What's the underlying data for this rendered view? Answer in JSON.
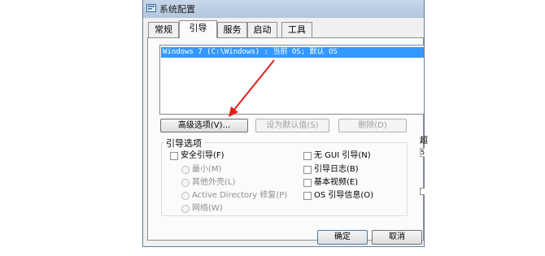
{
  "window": {
    "title": "系统配置"
  },
  "tabs": [
    {
      "label": "常规",
      "active": false
    },
    {
      "label": "引导",
      "active": true
    },
    {
      "label": "服务",
      "active": false
    },
    {
      "label": "启动",
      "active": false
    },
    {
      "label": "工具",
      "active": false
    }
  ],
  "boot_list": {
    "items": [
      "Windows 7 (C:\\Windows) : 当前 OS; 默认 OS"
    ],
    "selected_index": 0
  },
  "buttons": {
    "advanced": "高级选项(V)...",
    "set_default": "设为默认值(S)",
    "delete": "删除(D)",
    "ok": "确定",
    "cancel": "取消"
  },
  "boot_options": {
    "group_label": "引导选项",
    "safe_boot": "安全引导(F)",
    "minimal": "最小(M)",
    "alternate_shell": "其他外壳(L)",
    "active_directory_repair": "Active Directory 修复(P)",
    "network": "网络(W)",
    "no_gui_boot": "无 GUI 引导(N)",
    "boot_log": "引导日志(B)",
    "base_video": "基本视频(E)",
    "os_boot_info": "OS 引导信息(O)"
  },
  "right_partial": {
    "char1": "超",
    "char2": "5"
  },
  "colors": {
    "selection": "#3399ff",
    "arrow": "#e0201b",
    "title_bar": "#c9d8ea"
  }
}
